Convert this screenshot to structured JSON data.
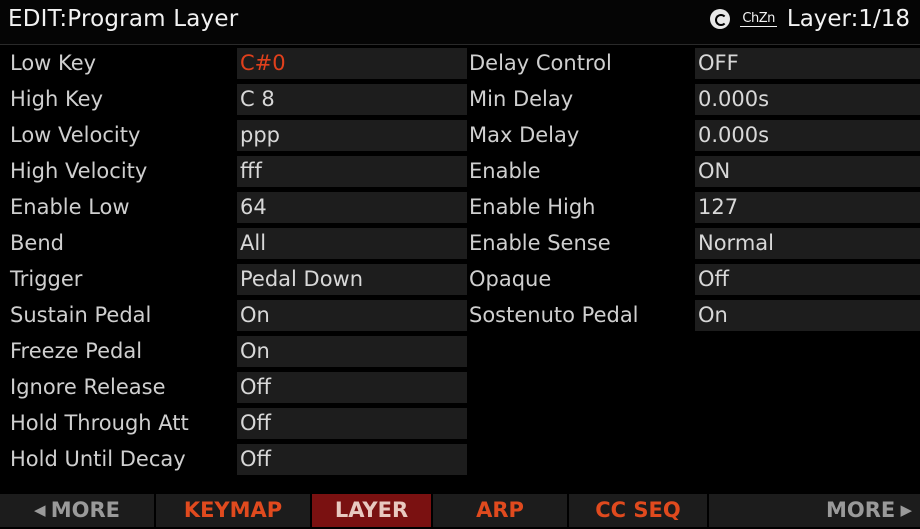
{
  "header": {
    "title": "EDIT:Program Layer",
    "chan_zone_label": "ChZn",
    "layer_label": "Layer:1/18"
  },
  "params_left": [
    {
      "label": "Low Key",
      "value": "C#0",
      "active": true
    },
    {
      "label": "High Key",
      "value": "C 8"
    },
    {
      "label": "Low Velocity",
      "value": "ppp"
    },
    {
      "label": "High Velocity",
      "value": "fff"
    },
    {
      "label": "Enable Low",
      "value": "64"
    },
    {
      "label": "Bend",
      "value": "All"
    },
    {
      "label": "Trigger",
      "value": "Pedal Down"
    },
    {
      "label": "Sustain Pedal",
      "value": "On"
    },
    {
      "label": "Freeze Pedal",
      "value": "On"
    },
    {
      "label": "Ignore Release",
      "value": "Off"
    },
    {
      "label": "Hold Through Att",
      "value": "Off"
    },
    {
      "label": "Hold Until Decay",
      "value": "Off"
    }
  ],
  "params_right": [
    {
      "label": "Delay Control",
      "value": "OFF"
    },
    {
      "label": "Min Delay",
      "value": "0.000s"
    },
    {
      "label": "Max Delay",
      "value": "0.000s"
    },
    {
      "label": "Enable",
      "value": "ON"
    },
    {
      "label": "Enable High",
      "value": "127"
    },
    {
      "label": "Enable Sense",
      "value": "Normal"
    },
    {
      "label": "Opaque",
      "value": "Off"
    },
    {
      "label": "Sostenuto Pedal",
      "value": "On"
    }
  ],
  "softbuttons": [
    {
      "label": "MORE"
    },
    {
      "label": "KEYMAP"
    },
    {
      "label": "LAYER",
      "selected": true
    },
    {
      "label": "ARP"
    },
    {
      "label": "CC SEQ"
    },
    {
      "label": "MORE"
    }
  ],
  "colors": {
    "accent_orange": "#e04a1e",
    "selected_tab": "#7a1111",
    "field_bg": "#1d1d1d"
  }
}
